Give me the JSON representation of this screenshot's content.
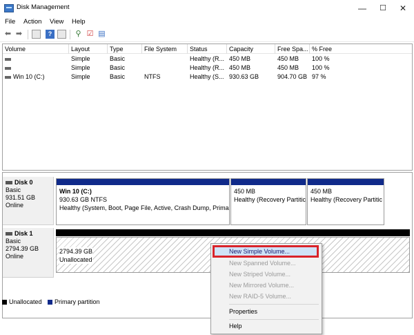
{
  "window": {
    "title": "Disk Management",
    "min": "—",
    "max": "☐",
    "close": "✕"
  },
  "menu": [
    "File",
    "Action",
    "View",
    "Help"
  ],
  "columns": [
    "Volume",
    "Layout",
    "Type",
    "File System",
    "Status",
    "Capacity",
    "Free Spa...",
    "% Free"
  ],
  "volumes": [
    {
      "name": "",
      "layout": "Simple",
      "type": "Basic",
      "fs": "",
      "status": "Healthy (R...",
      "capacity": "450 MB",
      "free": "450 MB",
      "pct": "100 %"
    },
    {
      "name": "",
      "layout": "Simple",
      "type": "Basic",
      "fs": "",
      "status": "Healthy (R...",
      "capacity": "450 MB",
      "free": "450 MB",
      "pct": "100 %"
    },
    {
      "name": "Win 10 (C:)",
      "layout": "Simple",
      "type": "Basic",
      "fs": "NTFS",
      "status": "Healthy (S...",
      "capacity": "930.63 GB",
      "free": "904.70 GB",
      "pct": "97 %"
    }
  ],
  "disk0": {
    "label": "Disk 0",
    "type": "Basic",
    "size": "931.51 GB",
    "state": "Online",
    "partitions": [
      {
        "title": "Win 10  (C:)",
        "line2": "930.63 GB NTFS",
        "line3": "Healthy (System, Boot, Page File, Active, Crash Dump, Primar"
      },
      {
        "title": "",
        "line2": "450 MB",
        "line3": "Healthy (Recovery Partitic"
      },
      {
        "title": "",
        "line2": "450 MB",
        "line3": "Healthy (Recovery Partitic"
      }
    ]
  },
  "disk1": {
    "label": "Disk 1",
    "type": "Basic",
    "size": "2794.39 GB",
    "state": "Online",
    "partition": {
      "line1": "2794.39 GB",
      "line2": "Unallocated"
    }
  },
  "legend": {
    "unallocated": "Unallocated",
    "primary": "Primary partition",
    "unallocated_color": "#000000",
    "primary_color": "#102a8a"
  },
  "context_menu": {
    "new_simple": "New Simple Volume...",
    "new_spanned": "New Spanned Volume...",
    "new_striped": "New Striped Volume...",
    "new_mirrored": "New Mirrored Volume...",
    "new_raid5": "New RAID-5 Volume...",
    "properties": "Properties",
    "help": "Help"
  }
}
